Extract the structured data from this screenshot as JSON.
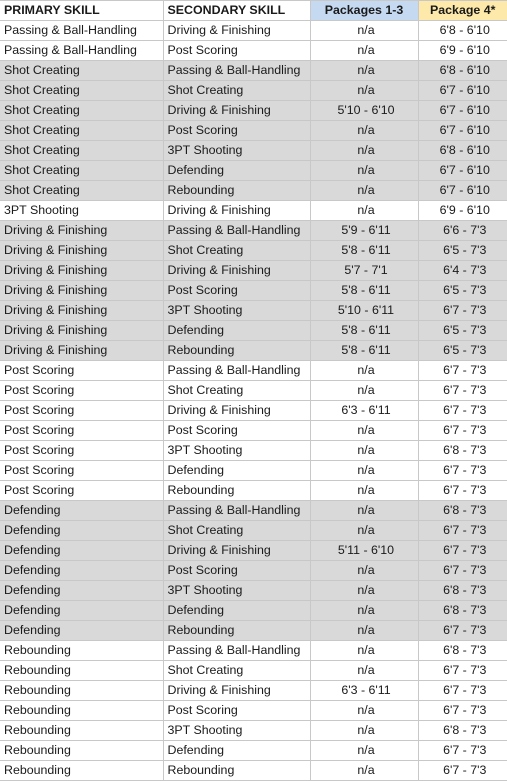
{
  "table": {
    "columns": [
      {
        "key": "primary",
        "label": "PRIMARY SKILL",
        "header_bg": "#ffffff",
        "align": "left"
      },
      {
        "key": "secondary",
        "label": "SECONDARY SKILL",
        "header_bg": "#ffffff",
        "align": "left"
      },
      {
        "key": "pkg13",
        "label": "Packages 1-3",
        "header_bg": "#c5d9f1",
        "align": "center"
      },
      {
        "key": "pkg4",
        "label": "Package 4*",
        "header_bg": "#fde9a9",
        "align": "center"
      }
    ],
    "colors": {
      "header_packages13_bg": "#c5d9f1",
      "header_package4_bg": "#fde9a9",
      "shaded_row_bg": "#d9d9d9",
      "plain_row_bg": "#ffffff",
      "grid_line": "#c8c8c8",
      "text": "#1a1a1a"
    },
    "rows": [
      {
        "primary": "Passing & Ball-Handling",
        "secondary": "Driving & Finishing",
        "pkg13": "n/a",
        "pkg4": "6'8 - 6'10",
        "shaded": false
      },
      {
        "primary": "Passing & Ball-Handling",
        "secondary": "Post Scoring",
        "pkg13": "n/a",
        "pkg4": "6'9 - 6'10",
        "shaded": false
      },
      {
        "primary": "Shot Creating",
        "secondary": "Passing & Ball-Handling",
        "pkg13": "n/a",
        "pkg4": "6'8 - 6'10",
        "shaded": true
      },
      {
        "primary": "Shot Creating",
        "secondary": "Shot Creating",
        "pkg13": "n/a",
        "pkg4": "6'7 - 6'10",
        "shaded": true
      },
      {
        "primary": "Shot Creating",
        "secondary": "Driving & Finishing",
        "pkg13": "5'10 - 6'10",
        "pkg4": "6'7 - 6'10",
        "shaded": true
      },
      {
        "primary": "Shot Creating",
        "secondary": "Post Scoring",
        "pkg13": "n/a",
        "pkg4": "6'7 - 6'10",
        "shaded": true
      },
      {
        "primary": "Shot Creating",
        "secondary": "3PT Shooting",
        "pkg13": "n/a",
        "pkg4": "6'8 - 6'10",
        "shaded": true
      },
      {
        "primary": "Shot Creating",
        "secondary": "Defending",
        "pkg13": "n/a",
        "pkg4": "6'7 - 6'10",
        "shaded": true
      },
      {
        "primary": "Shot Creating",
        "secondary": "Rebounding",
        "pkg13": "n/a",
        "pkg4": "6'7 - 6'10",
        "shaded": true
      },
      {
        "primary": "3PT Shooting",
        "secondary": "Driving & Finishing",
        "pkg13": "n/a",
        "pkg4": "6'9 - 6'10",
        "shaded": false
      },
      {
        "primary": "Driving & Finishing",
        "secondary": "Passing & Ball-Handling",
        "pkg13": "5'9 - 6'11",
        "pkg4": "6'6 - 7'3",
        "shaded": true
      },
      {
        "primary": "Driving & Finishing",
        "secondary": "Shot Creating",
        "pkg13": "5'8 - 6'11",
        "pkg4": "6'5 - 7'3",
        "shaded": true
      },
      {
        "primary": "Driving & Finishing",
        "secondary": "Driving & Finishing",
        "pkg13": "5'7 - 7'1",
        "pkg4": "6'4 - 7'3",
        "shaded": true
      },
      {
        "primary": "Driving & Finishing",
        "secondary": "Post Scoring",
        "pkg13": "5'8 - 6'11",
        "pkg4": "6'5 - 7'3",
        "shaded": true
      },
      {
        "primary": "Driving & Finishing",
        "secondary": "3PT Shooting",
        "pkg13": "5'10 - 6'11",
        "pkg4": "6'7 - 7'3",
        "shaded": true
      },
      {
        "primary": "Driving & Finishing",
        "secondary": "Defending",
        "pkg13": "5'8 - 6'11",
        "pkg4": "6'5 - 7'3",
        "shaded": true
      },
      {
        "primary": "Driving & Finishing",
        "secondary": "Rebounding",
        "pkg13": "5'8 - 6'11",
        "pkg4": "6'5 - 7'3",
        "shaded": true
      },
      {
        "primary": "Post Scoring",
        "secondary": "Passing & Ball-Handling",
        "pkg13": "n/a",
        "pkg4": "6'7 - 7'3",
        "shaded": false
      },
      {
        "primary": "Post Scoring",
        "secondary": "Shot Creating",
        "pkg13": "n/a",
        "pkg4": "6'7 - 7'3",
        "shaded": false
      },
      {
        "primary": "Post Scoring",
        "secondary": "Driving & Finishing",
        "pkg13": "6'3 - 6'11",
        "pkg4": "6'7 - 7'3",
        "shaded": false
      },
      {
        "primary": "Post Scoring",
        "secondary": "Post Scoring",
        "pkg13": "n/a",
        "pkg4": "6'7 - 7'3",
        "shaded": false
      },
      {
        "primary": "Post Scoring",
        "secondary": "3PT Shooting",
        "pkg13": "n/a",
        "pkg4": "6'8 - 7'3",
        "shaded": false
      },
      {
        "primary": "Post Scoring",
        "secondary": "Defending",
        "pkg13": "n/a",
        "pkg4": "6'7 - 7'3",
        "shaded": false
      },
      {
        "primary": "Post Scoring",
        "secondary": "Rebounding",
        "pkg13": "n/a",
        "pkg4": "6'7 - 7'3",
        "shaded": false
      },
      {
        "primary": "Defending",
        "secondary": "Passing & Ball-Handling",
        "pkg13": "n/a",
        "pkg4": "6'8 - 7'3",
        "shaded": true
      },
      {
        "primary": "Defending",
        "secondary": "Shot Creating",
        "pkg13": "n/a",
        "pkg4": "6'7 - 7'3",
        "shaded": true
      },
      {
        "primary": "Defending",
        "secondary": "Driving & Finishing",
        "pkg13": "5'11 - 6'10",
        "pkg4": "6'7 - 7'3",
        "shaded": true
      },
      {
        "primary": "Defending",
        "secondary": "Post Scoring",
        "pkg13": "n/a",
        "pkg4": "6'7 - 7'3",
        "shaded": true
      },
      {
        "primary": "Defending",
        "secondary": "3PT Shooting",
        "pkg13": "n/a",
        "pkg4": "6'8 - 7'3",
        "shaded": true
      },
      {
        "primary": "Defending",
        "secondary": "Defending",
        "pkg13": "n/a",
        "pkg4": "6'8 - 7'3",
        "shaded": true
      },
      {
        "primary": "Defending",
        "secondary": "Rebounding",
        "pkg13": "n/a",
        "pkg4": "6'7 - 7'3",
        "shaded": true
      },
      {
        "primary": "Rebounding",
        "secondary": "Passing & Ball-Handling",
        "pkg13": "n/a",
        "pkg4": "6'8 - 7'3",
        "shaded": false
      },
      {
        "primary": "Rebounding",
        "secondary": "Shot Creating",
        "pkg13": "n/a",
        "pkg4": "6'7 - 7'3",
        "shaded": false
      },
      {
        "primary": "Rebounding",
        "secondary": "Driving & Finishing",
        "pkg13": "6'3 - 6'11",
        "pkg4": "6'7 - 7'3",
        "shaded": false
      },
      {
        "primary": "Rebounding",
        "secondary": "Post Scoring",
        "pkg13": "n/a",
        "pkg4": "6'7 - 7'3",
        "shaded": false
      },
      {
        "primary": "Rebounding",
        "secondary": "3PT Shooting",
        "pkg13": "n/a",
        "pkg4": "6'8 - 7'3",
        "shaded": false
      },
      {
        "primary": "Rebounding",
        "secondary": "Defending",
        "pkg13": "n/a",
        "pkg4": "6'7 - 7'3",
        "shaded": false
      },
      {
        "primary": "Rebounding",
        "secondary": "Rebounding",
        "pkg13": "n/a",
        "pkg4": "6'7 - 7'3",
        "shaded": false
      }
    ]
  }
}
